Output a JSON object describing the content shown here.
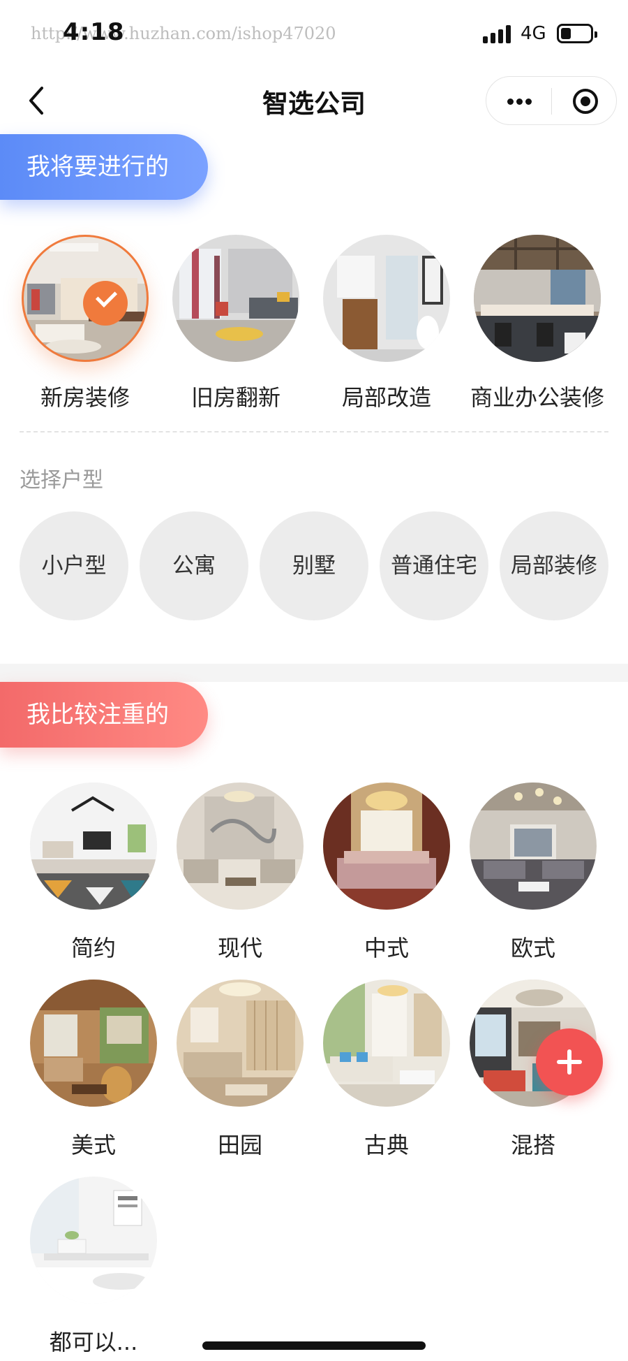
{
  "status_bar": {
    "time": "4:18",
    "network": "4G",
    "watermark": "http://www.huzhan.com/ishop47020"
  },
  "nav": {
    "title": "智选公司"
  },
  "section_plan": {
    "title": "我将要进行的",
    "items": [
      {
        "label": "新房装修",
        "selected": true
      },
      {
        "label": "旧房翻新",
        "selected": false
      },
      {
        "label": "局部改造",
        "selected": false
      },
      {
        "label": "商业办公装修",
        "selected": false
      }
    ]
  },
  "house_type": {
    "title": "选择户型",
    "options": [
      "小户型",
      "公寓",
      "别墅",
      "普通住宅",
      "局部装修"
    ]
  },
  "section_style": {
    "title": "我比较注重的",
    "items": [
      {
        "label": "简约"
      },
      {
        "label": "现代"
      },
      {
        "label": "中式"
      },
      {
        "label": "欧式"
      },
      {
        "label": "美式"
      },
      {
        "label": "田园"
      },
      {
        "label": "古典"
      },
      {
        "label": "混搭"
      },
      {
        "label": "都可以..."
      }
    ]
  },
  "colors": {
    "blue_banner": "#5c8bf7",
    "red_banner": "#f36a6a",
    "accent_orange": "#f07a3c",
    "fab_red": "#f25353"
  }
}
